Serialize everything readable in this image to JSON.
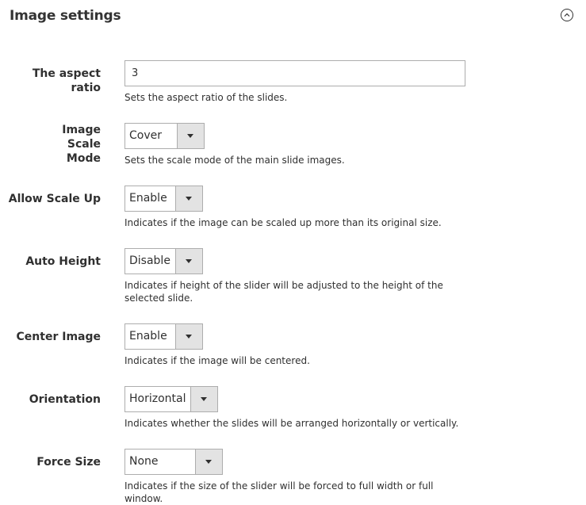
{
  "section": {
    "title": "Image settings"
  },
  "fields": {
    "aspect_ratio": {
      "label": "The aspect ratio",
      "value": "3",
      "note": "Sets the aspect ratio of the slides."
    },
    "image_scale_mode": {
      "label": "Image Scale Mode",
      "value": "Cover",
      "note": "Sets the scale mode of the main slide images."
    },
    "allow_scale_up": {
      "label": "Allow Scale Up",
      "value": "Enable",
      "note": "Indicates if the image can be scaled up more than its original size."
    },
    "auto_height": {
      "label": "Auto Height",
      "value": "Disable",
      "note": "Indicates if height of the slider will be adjusted to the height of the selected slide."
    },
    "center_image": {
      "label": "Center Image",
      "value": "Enable",
      "note": "Indicates if the image will be centered."
    },
    "orientation": {
      "label": "Orientation",
      "value": "Horizontal",
      "note": "Indicates whether the slides will be arranged horizontally or vertically."
    },
    "force_size": {
      "label": "Force Size",
      "value": "None",
      "note": "Indicates if the size of the slider will be forced to full width or full window."
    }
  },
  "icons": {
    "collapse": "chevron-up-circle-icon",
    "select_arrow": "caret-down-icon"
  },
  "colors": {
    "border": "#adadad",
    "arrow_bg": "#e3e3e3",
    "text": "#303030"
  }
}
